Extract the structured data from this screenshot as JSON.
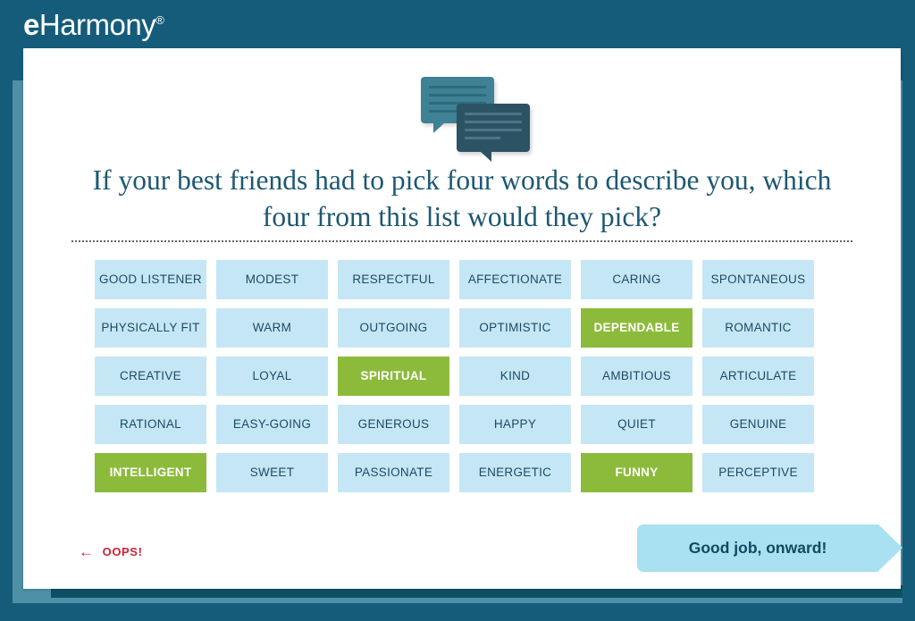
{
  "brand": {
    "logo_e": "e",
    "logo_rest": "Harmony",
    "logo_tm": "®"
  },
  "icon": {
    "name": "speech-bubbles-icon"
  },
  "heading": {
    "text": "If your best friends had to pick four words to describe you, which four from this list would they pick?"
  },
  "grid": {
    "columns": 6,
    "words": [
      {
        "label": "GOOD LISTENER",
        "selected": false
      },
      {
        "label": "MODEST",
        "selected": false
      },
      {
        "label": "RESPECTFUL",
        "selected": false
      },
      {
        "label": "AFFECTIONATE",
        "selected": false
      },
      {
        "label": "CARING",
        "selected": false
      },
      {
        "label": "SPONTANEOUS",
        "selected": false
      },
      {
        "label": "PHYSICALLY FIT",
        "selected": false
      },
      {
        "label": "WARM",
        "selected": false
      },
      {
        "label": "OUTGOING",
        "selected": false
      },
      {
        "label": "OPTIMISTIC",
        "selected": false
      },
      {
        "label": "DEPENDABLE",
        "selected": true
      },
      {
        "label": "ROMANTIC",
        "selected": false
      },
      {
        "label": "CREATIVE",
        "selected": false
      },
      {
        "label": "LOYAL",
        "selected": false
      },
      {
        "label": "SPIRITUAL",
        "selected": true
      },
      {
        "label": "KIND",
        "selected": false
      },
      {
        "label": "AMBITIOUS",
        "selected": false
      },
      {
        "label": "ARTICULATE",
        "selected": false
      },
      {
        "label": "RATIONAL",
        "selected": false
      },
      {
        "label": "EASY-GOING",
        "selected": false
      },
      {
        "label": "GENEROUS",
        "selected": false
      },
      {
        "label": "HAPPY",
        "selected": false
      },
      {
        "label": "QUIET",
        "selected": false
      },
      {
        "label": "GENUINE",
        "selected": false
      },
      {
        "label": "INTELLIGENT",
        "selected": true
      },
      {
        "label": "SWEET",
        "selected": false
      },
      {
        "label": "PASSIONATE",
        "selected": false
      },
      {
        "label": "ENERGETIC",
        "selected": false
      },
      {
        "label": "FUNNY",
        "selected": true
      },
      {
        "label": "PERCEPTIVE",
        "selected": false
      }
    ]
  },
  "footer": {
    "back_arrow": "←",
    "back_label": "OOPS!",
    "next_label": "Good job, onward!"
  },
  "colors": {
    "page_background": "#155c7a",
    "panel_teal": "#4e90a6",
    "panel_dark": "#0e5063",
    "card": "#ffffff",
    "heading": "#1d5872",
    "word_unselected_bg": "#c5e7f5",
    "word_unselected_text": "#1d4a5f",
    "word_selected_bg": "#8cbb3c",
    "word_selected_text": "#ffffff",
    "oops_red": "#cc2236",
    "next_button_bg": "#a9e0f2",
    "next_button_text": "#13495e"
  }
}
